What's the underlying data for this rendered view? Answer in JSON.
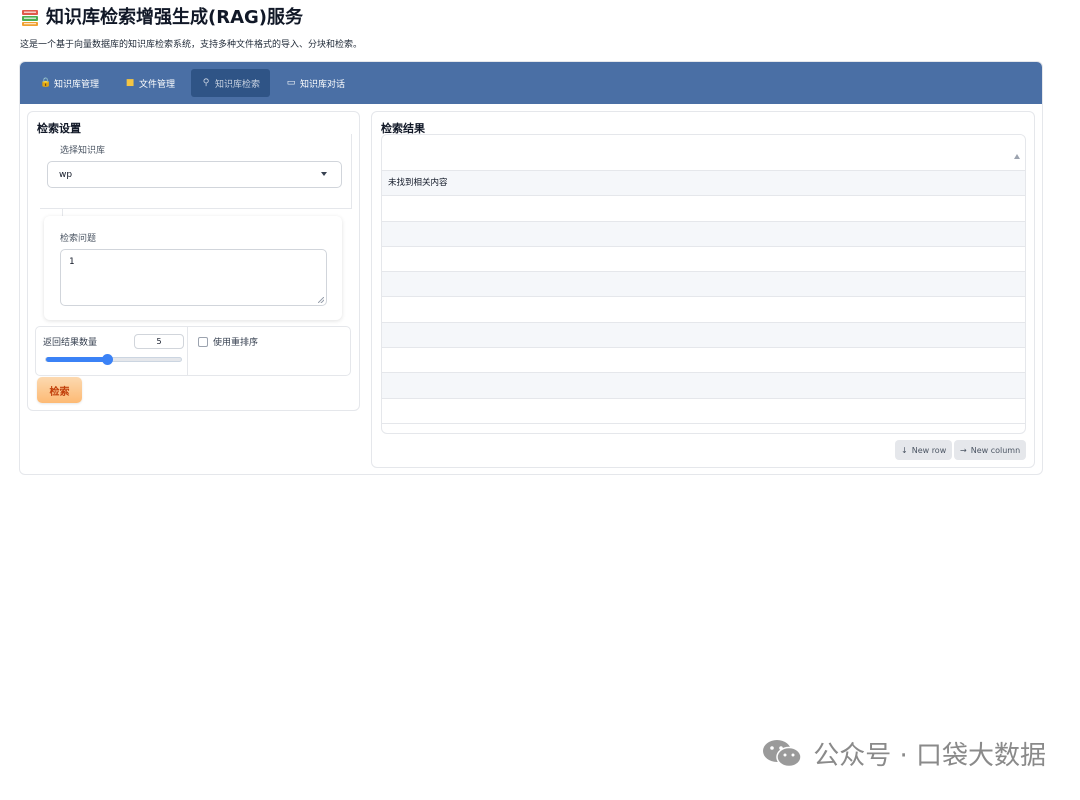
{
  "header": {
    "title": "知识库检索增强生成(RAG)服务",
    "description": "这是一个基于向量数据库的知识库检索系统，支持多种文件格式的导入、分块和检索。"
  },
  "tabs": [
    {
      "icon": "lock-icon",
      "label": "知识库管理",
      "active": false
    },
    {
      "icon": "folder-icon",
      "label": "文件管理",
      "active": false
    },
    {
      "icon": "search-icon",
      "label": "知识库检索",
      "active": true
    },
    {
      "icon": "speech-bubble-icon",
      "label": "知识库对话",
      "active": false
    }
  ],
  "search_settings": {
    "title": "检索设置",
    "kb_label": "选择知识库",
    "kb_value": "wp",
    "query_label": "检索问题",
    "query_value": "1",
    "topk_label": "返回结果数量",
    "topk_value": "5",
    "topk_fraction": 0.45,
    "rerank_label": "使用重排序",
    "rerank_checked": false,
    "search_button": "检索"
  },
  "results": {
    "title": "检索结果",
    "rows": [
      "未找到相关内容",
      "",
      "",
      "",
      "",
      "",
      "",
      "",
      "",
      ""
    ],
    "new_row": "New row",
    "new_column": "New column"
  },
  "watermark": {
    "text": "公众号 · 口袋大数据"
  },
  "colors": {
    "tabbar": "#4a6fa5",
    "active_tab": "#2f5486",
    "slider": "#3b82f6",
    "search_button": "#fdba74"
  }
}
